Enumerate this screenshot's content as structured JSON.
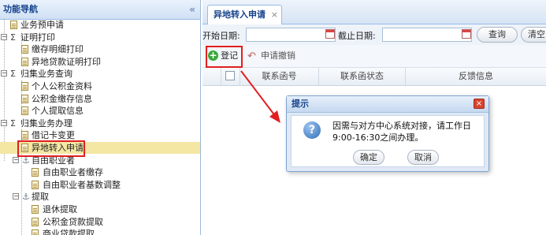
{
  "sidebar": {
    "title": "功能导航",
    "collapse_glyph": "«",
    "items": [
      {
        "label": "业务预申请",
        "type": "leaf"
      },
      {
        "label": "证明打印",
        "type": "group"
      },
      {
        "label": "缴存明细打印",
        "type": "leaf"
      },
      {
        "label": "异地贷款证明打印",
        "type": "leaf"
      },
      {
        "label": "归集业务查询",
        "type": "group"
      },
      {
        "label": "个人公积金资料",
        "type": "leaf"
      },
      {
        "label": "公积金缴存信息",
        "type": "leaf"
      },
      {
        "label": "个人提取信息",
        "type": "leaf"
      },
      {
        "label": "归集业务办理",
        "type": "group"
      },
      {
        "label": "借记卡变更",
        "type": "leaf"
      },
      {
        "label": "异地转入申请",
        "type": "leaf",
        "selected": true
      },
      {
        "label": "自由职业者",
        "type": "subgroup"
      },
      {
        "label": "自由职业者缴存",
        "type": "leaf"
      },
      {
        "label": "自由职业者基数调整",
        "type": "leaf"
      },
      {
        "label": "提取",
        "type": "subgroup"
      },
      {
        "label": "退休提取",
        "type": "leaf"
      },
      {
        "label": "公积金贷款提取",
        "type": "leaf"
      },
      {
        "label": "商业贷款提取",
        "type": "leaf"
      }
    ]
  },
  "tab": {
    "label": "异地转入申请",
    "close": "×"
  },
  "filter": {
    "start_date_label": "开始日期:",
    "end_date_label": "截止日期:",
    "start_date_value": "",
    "end_date_value": "",
    "query_label": "查询",
    "clear_label": "清空"
  },
  "toolbar": {
    "register_label": "登记",
    "revoke_label": "申请撤销"
  },
  "grid": {
    "columns": [
      "联系函号",
      "联系函状态",
      "反馈信息"
    ]
  },
  "dialog": {
    "title": "提示",
    "message": "因需与对方中心系统对接，请工作日9:00-16:30之间办理。",
    "ok_label": "确定",
    "cancel_label": "取消",
    "close_glyph": "×"
  },
  "colors": {
    "highlight": "#e02020",
    "selected_row": "#f3e7a3",
    "accent": "#15428b"
  }
}
